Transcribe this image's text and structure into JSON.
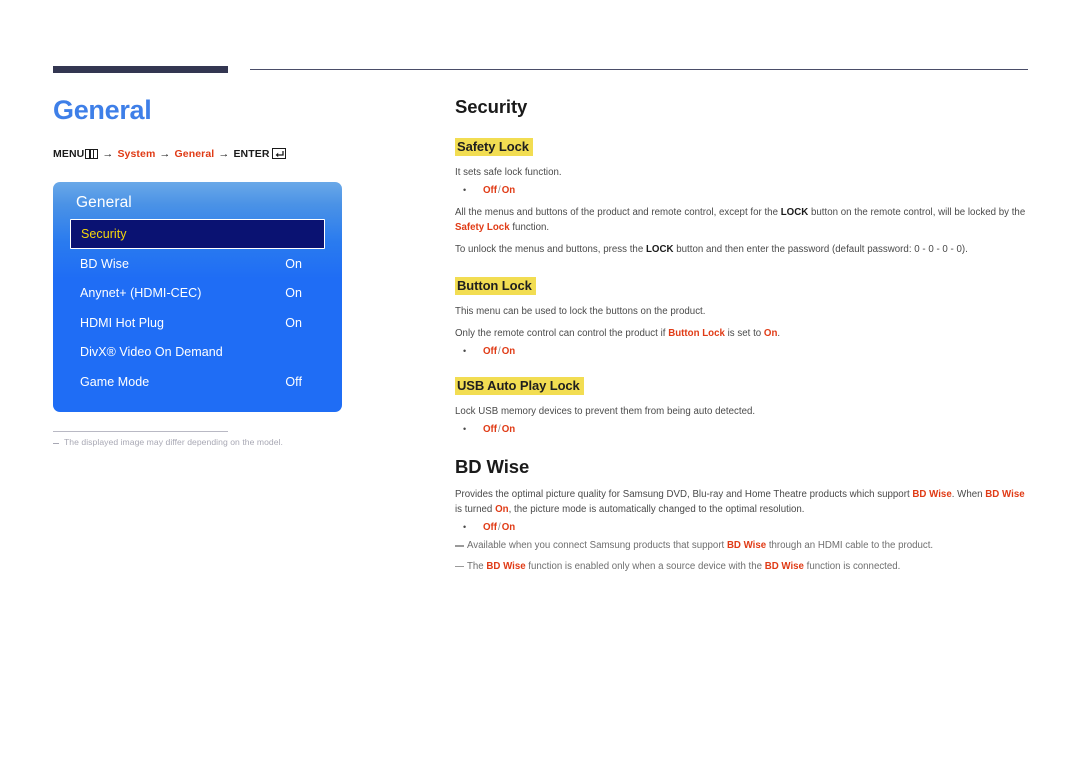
{
  "header": {
    "rule_color": "#333651"
  },
  "left": {
    "page_title": "General",
    "breadcrumb": {
      "menu_label": "MENU",
      "menu_icon": "menu-grid-icon",
      "arrow": "→",
      "system_label": "System",
      "general_label": "General",
      "enter_label": "ENTER",
      "enter_icon": "enter-key-icon"
    },
    "osd": {
      "title": "General",
      "rows": [
        {
          "label": "Security",
          "value": "",
          "selected": true
        },
        {
          "label": "BD Wise",
          "value": "On",
          "selected": false
        },
        {
          "label": "Anynet+ (HDMI-CEC)",
          "value": "On",
          "selected": false
        },
        {
          "label": "HDMI Hot Plug",
          "value": "On",
          "selected": false
        },
        {
          "label": "DivX® Video On Demand",
          "value": "",
          "selected": false
        },
        {
          "label": "Game Mode",
          "value": "Off",
          "selected": false
        }
      ],
      "highlight_text_color": "#f5d60a",
      "highlight_bg_color": "#0a1272",
      "panel_color": "#1f6df5"
    },
    "footnote": "The displayed image may differ depending on the model."
  },
  "right": {
    "security": {
      "heading": "Security",
      "safety_lock": {
        "heading": "Safety Lock",
        "desc": "It sets safe lock function.",
        "options": {
          "off": "Off",
          "sep": "/",
          "on": "On"
        },
        "para_2_a": "All the menus and buttons of the product and remote control, except for the ",
        "para_2_lock": "LOCK",
        "para_2_b": " button on the remote control, will be locked by the ",
        "para_2_safety": "Safety Lock",
        "para_2_c": " function.",
        "para_3_a": "To unlock the menus and buttons, press the ",
        "para_3_lock": "LOCK",
        "para_3_b": " button and then enter the password (default password: 0 - 0 - 0 - 0)."
      },
      "button_lock": {
        "heading": "Button Lock",
        "desc_1": "This menu can be used to lock the buttons on the product.",
        "desc_2_a": "Only the remote control can control the product if ",
        "desc_2_name": "Button Lock",
        "desc_2_b": " is set to ",
        "desc_2_on": "On",
        "desc_2_c": ".",
        "options": {
          "off": "Off",
          "sep": "/",
          "on": "On"
        }
      },
      "usb_auto_play_lock": {
        "heading": "USB Auto Play Lock",
        "desc": "Lock USB memory devices to prevent them from being auto detected.",
        "options": {
          "off": "Off",
          "sep": "/",
          "on": "On"
        }
      }
    },
    "bd_wise": {
      "heading": "BD Wise",
      "desc_a": "Provides the optimal picture quality for Samsung DVD, Blu-ray and Home Theatre products which support ",
      "desc_name_1": "BD Wise",
      "desc_b": ". When ",
      "desc_name_2": "BD Wise",
      "desc_c": " is turned ",
      "desc_on": "On",
      "desc_d": ", the picture mode is automatically changed to the optimal resolution.",
      "options": {
        "off": "Off",
        "sep": "/",
        "on": "On"
      },
      "note_1_a": "Available when you connect Samsung products that support ",
      "note_1_name": "BD Wise",
      "note_1_b": " through an HDMI cable to the product.",
      "note_2_a": "The ",
      "note_2_name_1": "BD Wise",
      "note_2_b": " function is enabled only when a source device with the ",
      "note_2_name_2": "BD Wise",
      "note_2_c": " function is connected."
    }
  }
}
